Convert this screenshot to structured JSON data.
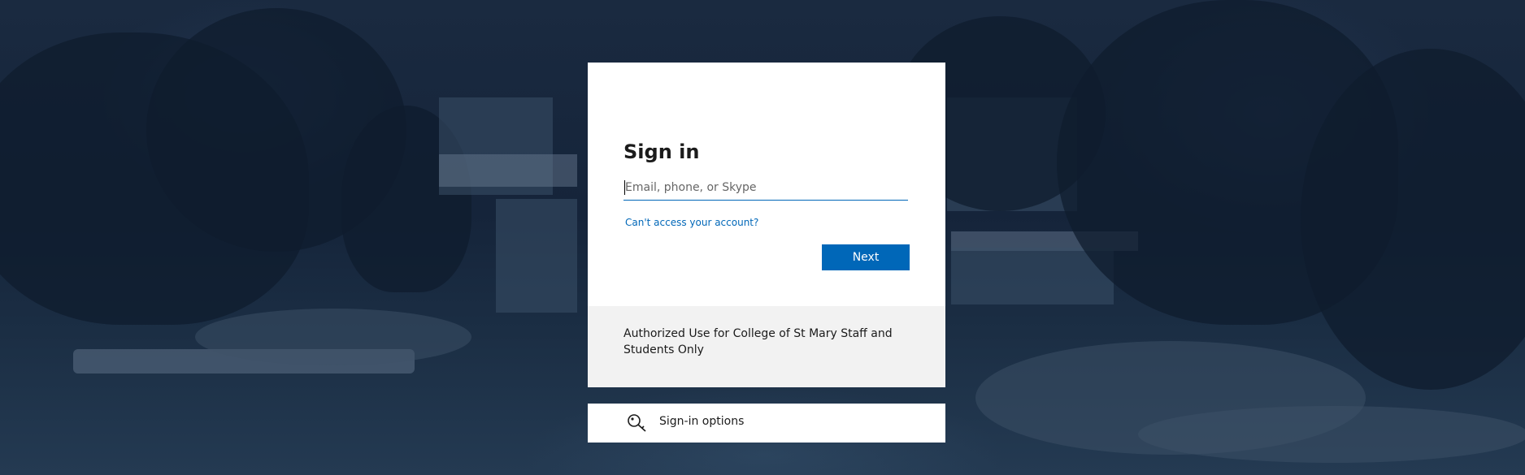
{
  "signin": {
    "title": "Sign in",
    "email_placeholder": "Email, phone, or Skype",
    "email_value": "",
    "cant_access_link": "Can't access your account?",
    "next_button": "Next"
  },
  "notice": {
    "text": "Authorized Use for College of St Mary Staff and Students Only"
  },
  "options": {
    "label": "Sign-in options",
    "icon": "key-icon"
  },
  "colors": {
    "accent": "#0067b8",
    "background": "#1a2a40",
    "card": "#ffffff",
    "notice_bg": "#f2f2f2"
  }
}
